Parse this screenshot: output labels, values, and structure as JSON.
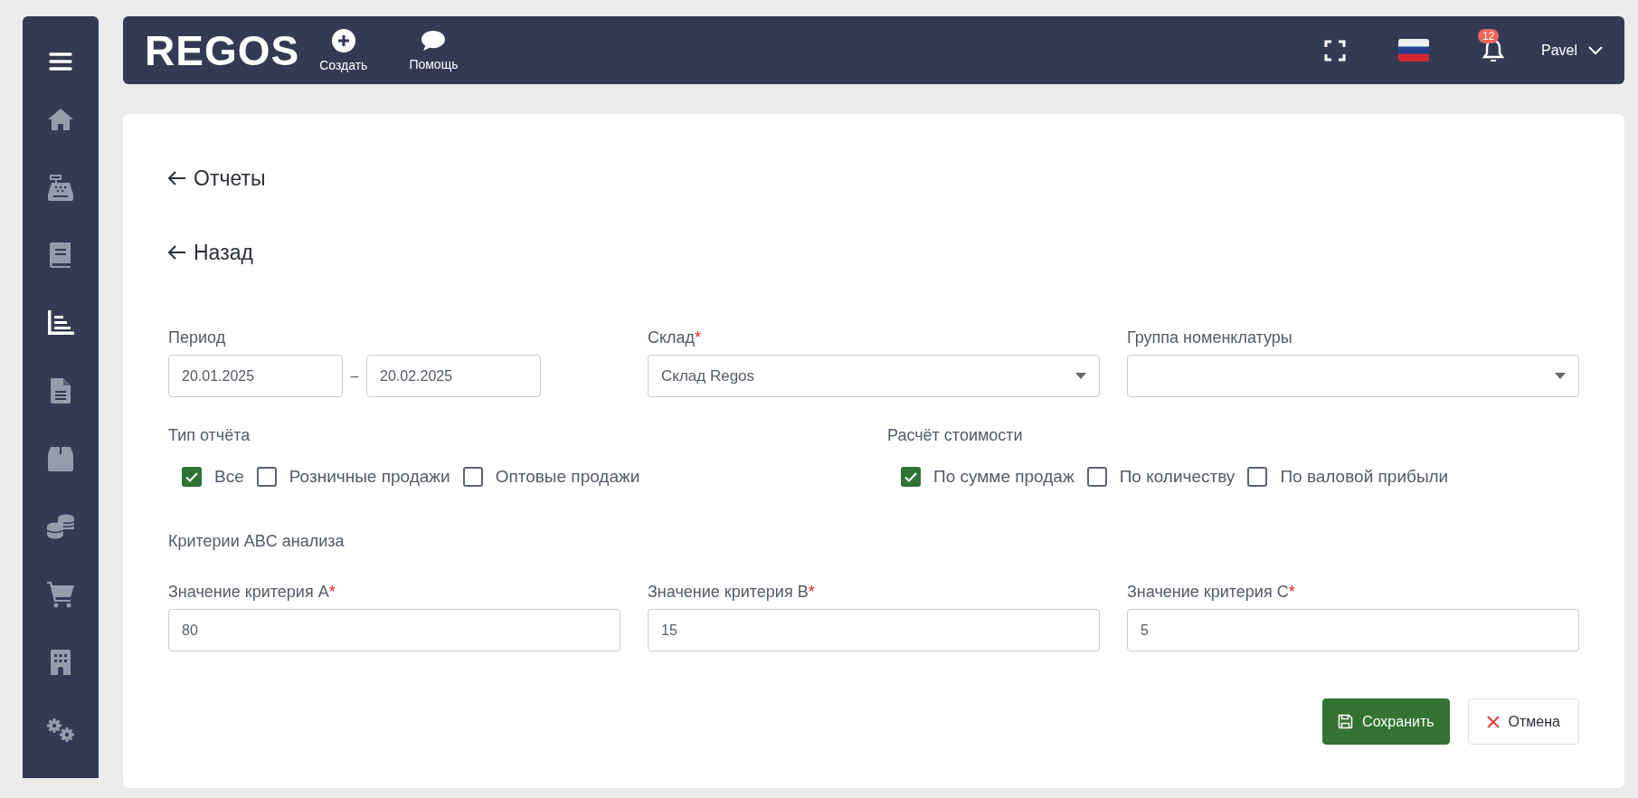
{
  "sidebar": {
    "items": [
      {
        "kind": "home",
        "selected": false
      },
      {
        "kind": "register",
        "selected": false
      },
      {
        "kind": "book",
        "selected": false
      },
      {
        "kind": "chart",
        "selected": true
      },
      {
        "kind": "document",
        "selected": false
      },
      {
        "kind": "box",
        "selected": false
      },
      {
        "kind": "coins",
        "selected": false
      },
      {
        "kind": "cart",
        "selected": false
      },
      {
        "kind": "building",
        "selected": false
      },
      {
        "kind": "gears",
        "selected": false
      }
    ]
  },
  "topbar": {
    "logo": "REGOS",
    "actions": [
      {
        "kind": "create",
        "label": "Создать"
      },
      {
        "kind": "help",
        "label": "Помощь"
      }
    ],
    "notification_count": "12",
    "user": "Pavel"
  },
  "back_links": [
    "Отчеты",
    "Назад"
  ],
  "form": {
    "period": {
      "label": "Период",
      "from": "20.01.2025",
      "separator": "–",
      "to": "20.02.2025"
    },
    "selects": [
      {
        "label": "Склад",
        "required_mark": "*",
        "value": "Склад Regos"
      },
      {
        "label": "Группа номенклатуры"
      }
    ],
    "option_groups": [
      {
        "label": "Тип отчёта",
        "options": [
          {
            "label": "Все",
            "checked": true
          },
          {
            "label": "Розничные продажи",
            "checked": false
          },
          {
            "label": "Оптовые продажи",
            "checked": false
          }
        ]
      },
      {
        "label": "Расчёт стоимости",
        "options": [
          {
            "label": "По сумме продаж",
            "checked": true
          },
          {
            "label": "По количеству",
            "checked": false
          },
          {
            "label": "По валовой прибыли",
            "checked": false
          }
        ]
      }
    ],
    "criteria_title": "Критерии ABC анализа",
    "criteria": [
      {
        "label": "Значение критерия A",
        "required_mark": "*",
        "value": "80"
      },
      {
        "label": "Значение критерия B",
        "required_mark": "*",
        "value": "15"
      },
      {
        "label": "Значение критерия C",
        "required_mark": "*",
        "value": "5"
      }
    ]
  },
  "buttons": [
    {
      "kind": "save",
      "label": "Сохранить"
    },
    {
      "kind": "cancel",
      "label": "Отмена"
    }
  ]
}
